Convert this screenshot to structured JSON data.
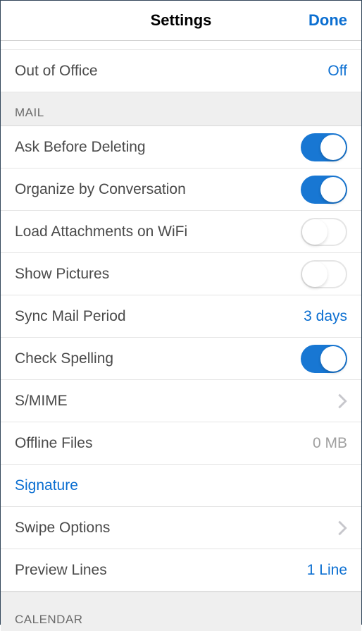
{
  "header": {
    "title": "Settings",
    "done": "Done"
  },
  "rows": {
    "outOfOffice": {
      "label": "Out of Office",
      "value": "Off"
    },
    "askBeforeDeleting": {
      "label": "Ask Before Deleting"
    },
    "organizeByConversation": {
      "label": "Organize by Conversation"
    },
    "loadAttachments": {
      "label": "Load Attachments on WiFi"
    },
    "showPictures": {
      "label": "Show Pictures"
    },
    "syncMailPeriod": {
      "label": "Sync Mail Period",
      "value": "3 days"
    },
    "checkSpelling": {
      "label": "Check Spelling"
    },
    "smime": {
      "label": "S/MIME"
    },
    "offlineFiles": {
      "label": "Offline Files",
      "value": "0 MB"
    },
    "signature": {
      "label": "Signature"
    },
    "swipeOptions": {
      "label": "Swipe Options"
    },
    "previewLines": {
      "label": "Preview Lines",
      "value": "1 Line"
    }
  },
  "sections": {
    "mail": "MAIL",
    "calendar": "CALENDAR"
  },
  "toggles": {
    "askBeforeDeleting": true,
    "organizeByConversation": true,
    "loadAttachments": false,
    "showPictures": false,
    "checkSpelling": true
  }
}
